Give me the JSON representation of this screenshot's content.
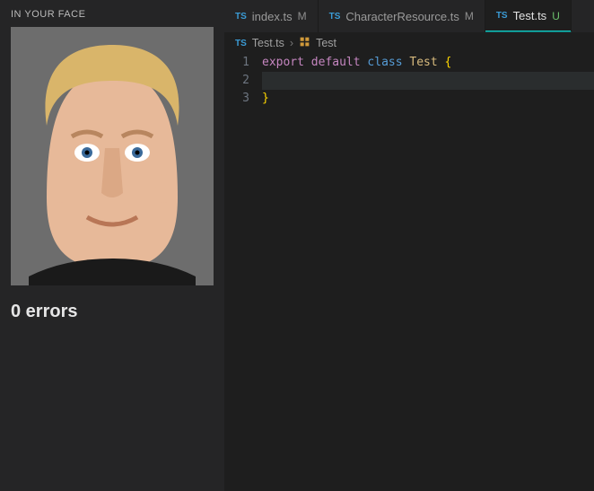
{
  "sidebar": {
    "panel_title": "IN YOUR FACE",
    "errors_label": "0 errors"
  },
  "tabs": [
    {
      "icon": "TS",
      "name": "index.ts",
      "status": "M",
      "status_kind": "mod",
      "active": false
    },
    {
      "icon": "TS",
      "name": "CharacterResource.ts",
      "status": "M",
      "status_kind": "mod",
      "active": false
    },
    {
      "icon": "TS",
      "name": "Test.ts",
      "status": "U",
      "status_kind": "u",
      "active": true
    }
  ],
  "breadcrumb": {
    "file_icon": "TS",
    "file": "Test.ts",
    "sep": "›",
    "symbol": "Test"
  },
  "code": {
    "lines": [
      {
        "n": "1",
        "tokens": [
          [
            "kw",
            "export "
          ],
          [
            "kw",
            "default "
          ],
          [
            "kw2",
            "class "
          ],
          [
            "cls",
            "Test "
          ],
          [
            "brace",
            "{"
          ]
        ]
      },
      {
        "n": "2",
        "tokens": [
          [
            "plain",
            ""
          ]
        ],
        "current": true
      },
      {
        "n": "3",
        "tokens": [
          [
            "brace",
            "}"
          ]
        ]
      }
    ]
  }
}
